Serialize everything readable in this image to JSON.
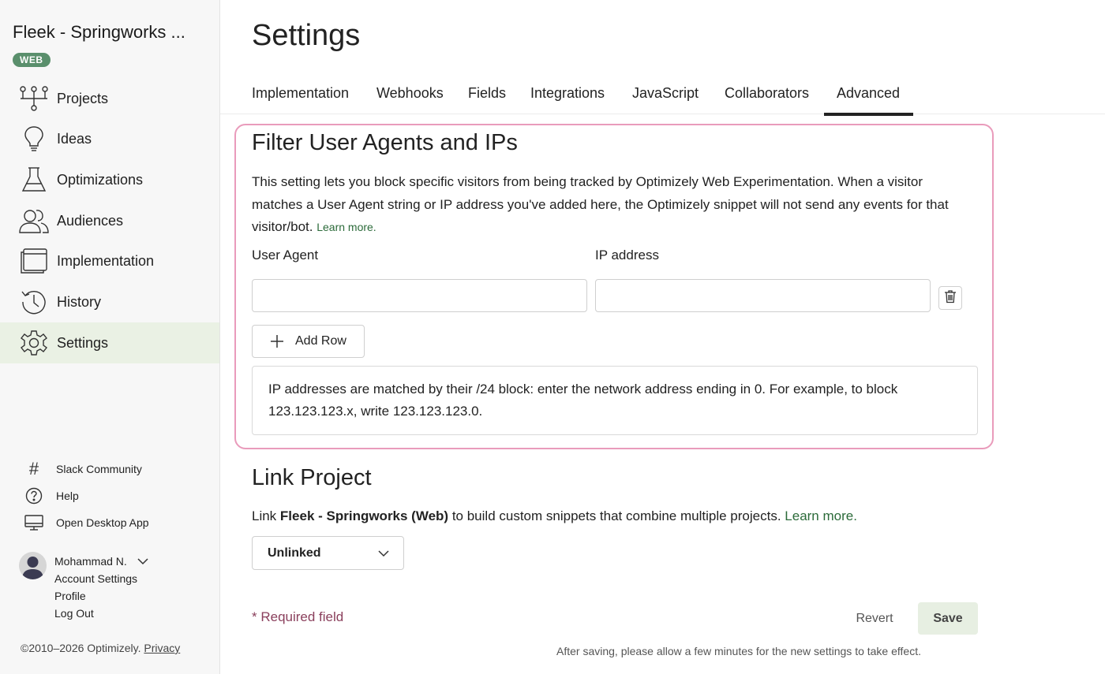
{
  "sidebar": {
    "project_title": "Fleek - Springworks ...",
    "project_badge": "WEB",
    "nav_items": [
      {
        "label": "Projects",
        "icon": "projects-icon"
      },
      {
        "label": "Ideas",
        "icon": "lightbulb-icon"
      },
      {
        "label": "Optimizations",
        "icon": "flask-icon"
      },
      {
        "label": "Audiences",
        "icon": "users-icon"
      },
      {
        "label": "Implementation",
        "icon": "window-icon"
      },
      {
        "label": "History",
        "icon": "history-icon"
      },
      {
        "label": "Settings",
        "icon": "gear-icon",
        "active": true
      }
    ],
    "footer_links": [
      {
        "label": "Slack Community",
        "icon": "hash-icon"
      },
      {
        "label": "Help",
        "icon": "help-circle-icon"
      },
      {
        "label": "Open Desktop App",
        "icon": "monitor-icon"
      }
    ],
    "user": {
      "name": "Mohammad N.",
      "links": [
        "Account Settings",
        "Profile",
        "Log Out"
      ]
    },
    "copyright": "©2010–2026 Optimizely.",
    "privacy_link": "Privacy"
  },
  "main": {
    "page_title": "Settings",
    "tabs": [
      {
        "label": "Implementation"
      },
      {
        "label": "Webhooks"
      },
      {
        "label": "Fields"
      },
      {
        "label": "Integrations"
      },
      {
        "label": "JavaScript"
      },
      {
        "label": "Collaborators"
      },
      {
        "label": "Advanced",
        "active": true
      }
    ],
    "filter_section": {
      "heading": "Filter User Agents and IPs",
      "description": "This setting lets you block specific visitors from being tracked by Optimizely Web Experimentation. When a visitor matches a User Agent string or IP address you've added here, the Optimizely snippet will not send any events for that visitor/bot.",
      "learn_more": "Learn more.",
      "user_agent_label": "User Agent",
      "ip_label": "IP address",
      "user_agent_value": "",
      "ip_value": "",
      "add_row_label": "Add Row",
      "info_text": "IP addresses are matched by their /24 block: enter the network address ending in 0. For example, to block 123.123.123.x, write 123.123.123.0."
    },
    "link_section": {
      "heading": "Link Project",
      "desc_prefix": "Link",
      "project_name": "Fleek - Springworks (Web)",
      "desc_suffix": "to build custom snippets that combine multiple projects.",
      "learn_more": "Learn more.",
      "select_value": "Unlinked"
    },
    "footer": {
      "required_text": "* Required field",
      "revert_label": "Revert",
      "save_label": "Save",
      "save_note": "After saving, please allow a few minutes for the new settings to take effect."
    }
  },
  "colors": {
    "badge": "#5a8f6c",
    "active_nav_bg": "#eaf1e4",
    "highlight_border": "#e99bbb",
    "link_green": "#2c6b3a",
    "required_text": "#8a3f5c",
    "save_bg": "#e7efe2"
  }
}
